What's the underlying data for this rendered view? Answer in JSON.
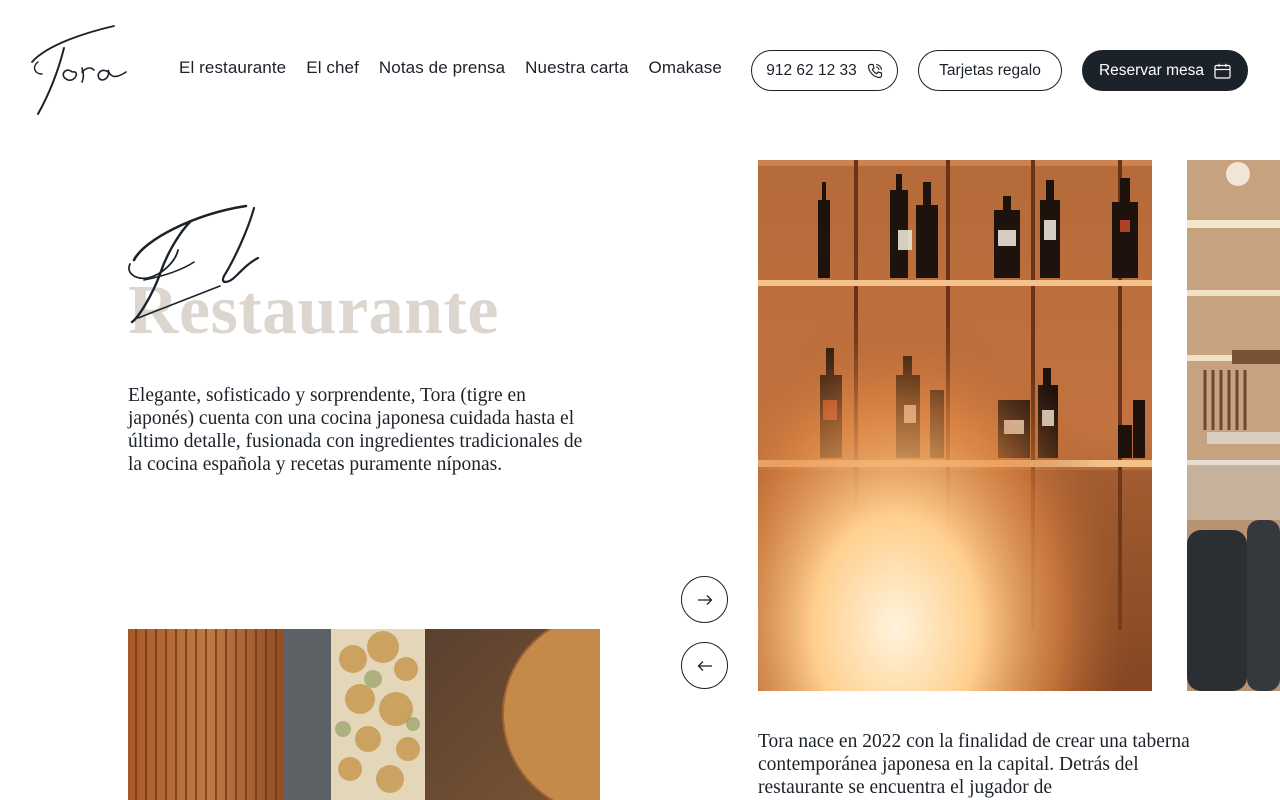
{
  "brand": {
    "logo_text": "Tora"
  },
  "nav": {
    "items": [
      {
        "label": "El restaurante"
      },
      {
        "label": "El chef"
      },
      {
        "label": "Notas de prensa"
      },
      {
        "label": "Nuestra carta"
      },
      {
        "label": "Omakase"
      }
    ]
  },
  "actions": {
    "phone_label": "912 62 12 33",
    "gift_label": "Tarjetas regalo",
    "book_label": "Reservar mesa"
  },
  "hero": {
    "script_word": "El",
    "title": "Restaurante",
    "intro": "Elegante, sofisticado y sorprendente, Tora (tigre en japonés) cuenta con una cocina japonesa cuidada hasta el último detalle, fusionada con ingredientes tradicionales de la cocina española y recetas puramente níponas."
  },
  "gallery": {
    "next_icon": "arrow-right-icon",
    "prev_icon": "arrow-left-icon"
  },
  "story": {
    "text": "Tora nace en 2022 con la finalidad de crear una taberna contemporánea japonesa en la capital. Detrás del restaurante se encuentra el jugador de"
  },
  "colors": {
    "ink": "#1c2229",
    "title_muted": "#dcd6cf",
    "background": "#ffffff"
  }
}
